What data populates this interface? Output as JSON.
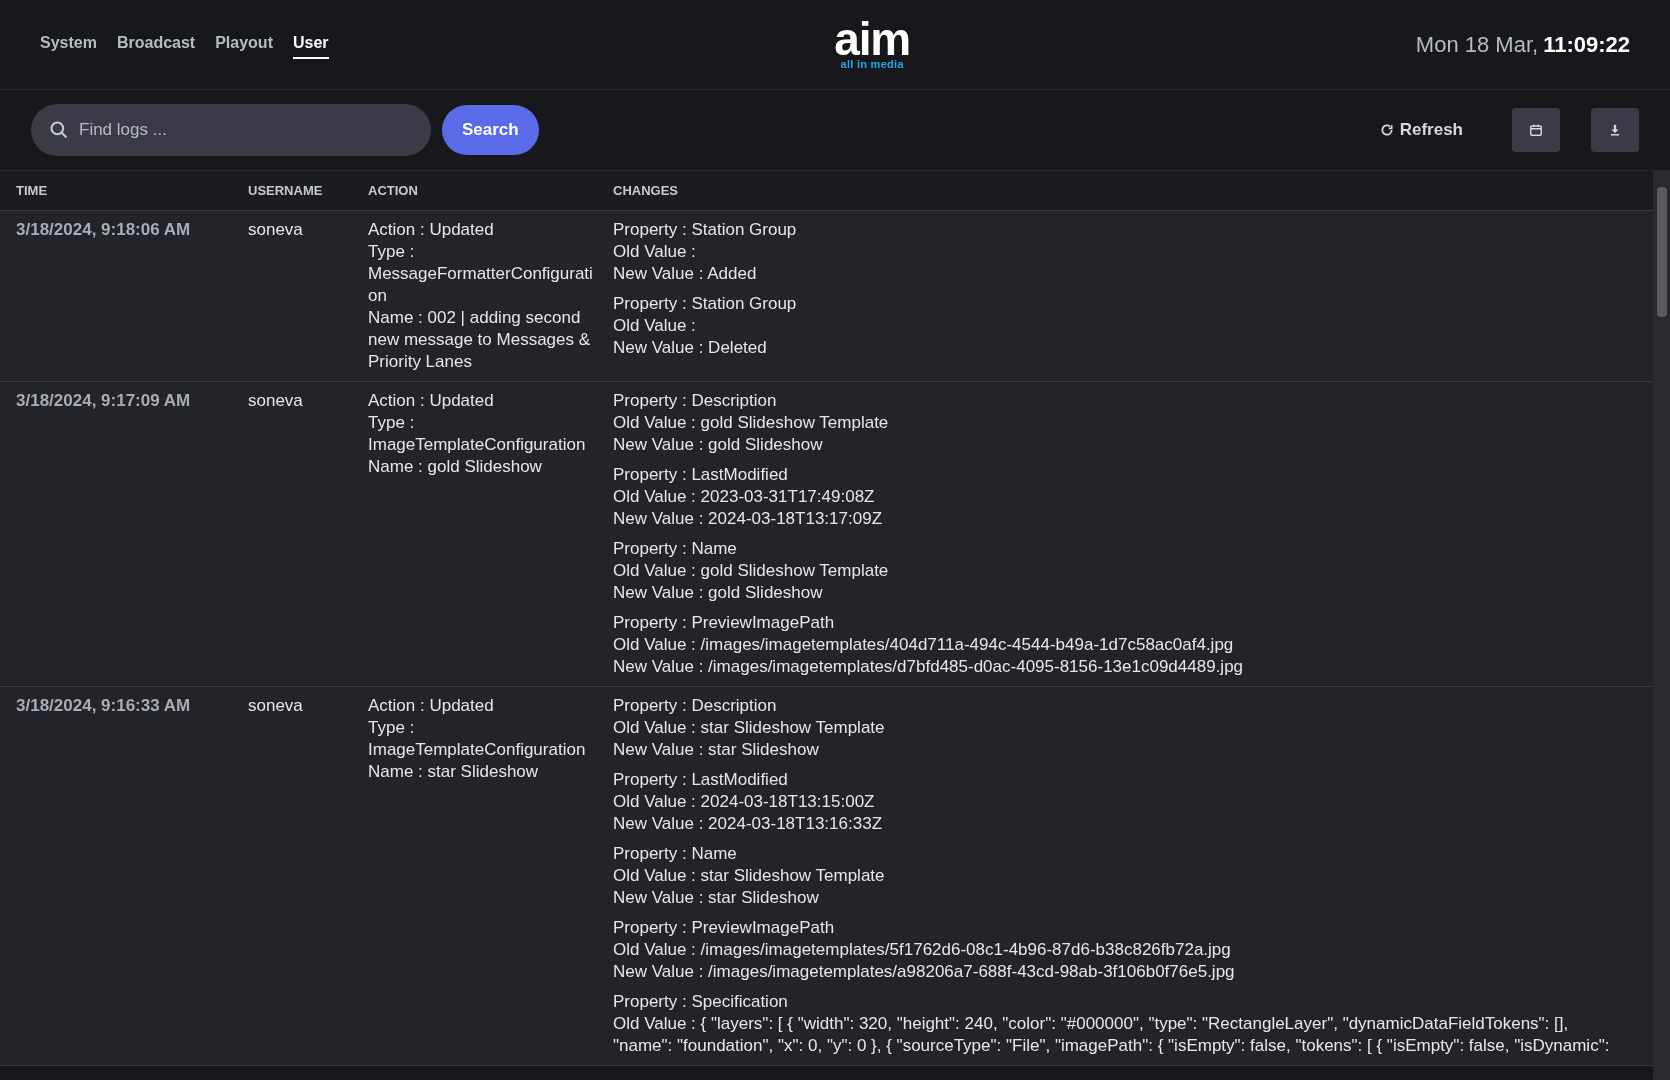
{
  "nav": {
    "tabs": [
      {
        "label": "System",
        "selected": false
      },
      {
        "label": "Broadcast",
        "selected": false
      },
      {
        "label": "Playout",
        "selected": false
      },
      {
        "label": "User",
        "selected": true
      }
    ]
  },
  "logo": {
    "wordmark": "aim",
    "tagline": "all in media"
  },
  "clock": {
    "date": "Mon 18 Mar,",
    "time": "11:09:22"
  },
  "toolbar": {
    "search": {
      "placeholder": "Find logs ..."
    },
    "search_button": "Search",
    "refresh_button": "Refresh"
  },
  "table": {
    "columns": [
      "TIME",
      "USERNAME",
      "ACTION",
      "CHANGES"
    ],
    "rows": [
      {
        "time": "3/18/2024, 9:18:06 AM",
        "username": "soneva",
        "action": [
          "Action : Updated",
          "Type : MessageFormatterConfiguration",
          "Name : 002 | adding second new message to Messages & Priority Lanes"
        ],
        "changes": [
          [
            "Property : Station Group",
            "Old Value :",
            "New Value : Added"
          ],
          [
            "Property : Station Group",
            "Old Value :",
            "New Value : Deleted"
          ]
        ]
      },
      {
        "time": "3/18/2024, 9:17:09 AM",
        "username": "soneva",
        "action": [
          "Action : Updated",
          "Type : ImageTemplateConfiguration",
          "Name : gold Slideshow"
        ],
        "changes": [
          [
            "Property : Description",
            "Old Value : gold Slideshow Template",
            "New Value : gold Slideshow"
          ],
          [
            "Property : LastModified",
            "Old Value : 2023-03-31T17:49:08Z",
            "New Value : 2024-03-18T13:17:09Z"
          ],
          [
            "Property : Name",
            "Old Value : gold Slideshow Template",
            "New Value : gold Slideshow"
          ],
          [
            "Property : PreviewImagePath",
            "Old Value : /images/imagetemplates/404d711a-494c-4544-b49a-1d7c58ac0af4.jpg",
            "New Value : /images/imagetemplates/d7bfd485-d0ac-4095-8156-13e1c09d4489.jpg"
          ]
        ]
      },
      {
        "time": "3/18/2024, 9:16:33 AM",
        "username": "soneva",
        "action": [
          "Action : Updated",
          "Type : ImageTemplateConfiguration",
          "Name : star Slideshow"
        ],
        "changes": [
          [
            "Property : Description",
            "Old Value : star Slideshow Template",
            "New Value : star Slideshow"
          ],
          [
            "Property : LastModified",
            "Old Value : 2024-03-18T13:15:00Z",
            "New Value : 2024-03-18T13:16:33Z"
          ],
          [
            "Property : Name",
            "Old Value : star Slideshow Template",
            "New Value : star Slideshow"
          ],
          [
            "Property : PreviewImagePath",
            "Old Value : /images/imagetemplates/5f1762d6-08c1-4b96-87d6-b38c826fb72a.jpg",
            "New Value : /images/imagetemplates/a98206a7-688f-43cd-98ab-3f106b0f76e5.jpg"
          ],
          [
            "Property : Specification",
            "Old Value : { \"layers\": [ { \"width\": 320, \"height\": 240, \"color\": \"#000000\", \"type\": \"RectangleLayer\", \"dynamicDataFieldTokens\": [], \"name\": \"foundation\", \"x\": 0, \"y\": 0 }, { \"sourceType\": \"File\", \"imagePath\": { \"isEmpty\": false, \"tokens\": [ { \"isEmpty\": false, \"isDynamic\":"
          ]
        ]
      }
    ]
  }
}
